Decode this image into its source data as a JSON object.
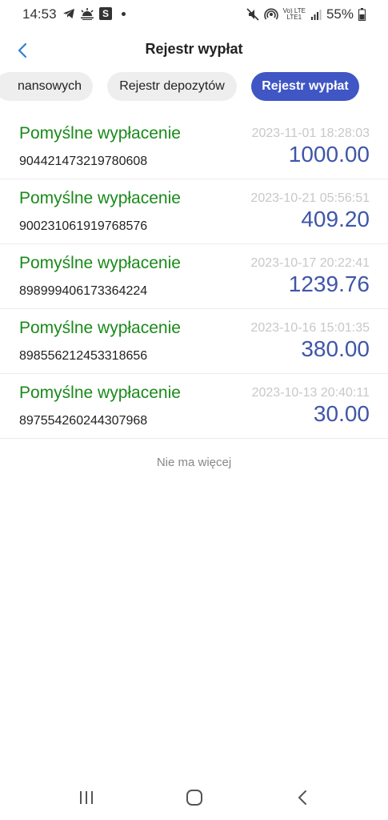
{
  "status_bar": {
    "time": "14:53",
    "battery": "55%",
    "lte_top": "Vo) LTE",
    "lte_bottom": "LTE1",
    "icons": [
      "telegram-icon",
      "weather-icon",
      "s-app-icon",
      "notification-dot-icon",
      "mute-icon",
      "hotspot-icon",
      "lte-icon",
      "signal-icon",
      "battery-icon"
    ],
    "s_letter": "S"
  },
  "header": {
    "title": "Rejestr wypłat"
  },
  "tabs": [
    {
      "label": "nansowych",
      "active": false
    },
    {
      "label": "Rejestr depozytów",
      "active": false
    },
    {
      "label": "Rejestr wypłat",
      "active": true
    }
  ],
  "records": [
    {
      "status": "Pomyślne wypłacenie",
      "id": "904421473219780608",
      "date": "2023-11-01 18:28:03",
      "amount": "1000.00"
    },
    {
      "status": "Pomyślne wypłacenie",
      "id": "900231061919768576",
      "date": "2023-10-21 05:56:51",
      "amount": "409.20"
    },
    {
      "status": "Pomyślne wypłacenie",
      "id": "898999406173364224",
      "date": "2023-10-17 20:22:41",
      "amount": "1239.76"
    },
    {
      "status": "Pomyślne wypłacenie",
      "id": "898556212453318656",
      "date": "2023-10-16 15:01:35",
      "amount": "380.00"
    },
    {
      "status": "Pomyślne wypłacenie",
      "id": "897554260244307968",
      "date": "2023-10-13 20:40:11",
      "amount": "30.00"
    }
  ],
  "footer_text": "Nie ma więcej",
  "colors": {
    "accent": "#3f56c4",
    "success": "#1a8a1a",
    "amount": "#3f56a8",
    "back_arrow": "#2d7fd6"
  },
  "nav_bar": {
    "icons": [
      "recent-apps-icon",
      "home-icon",
      "back-nav-icon"
    ]
  }
}
